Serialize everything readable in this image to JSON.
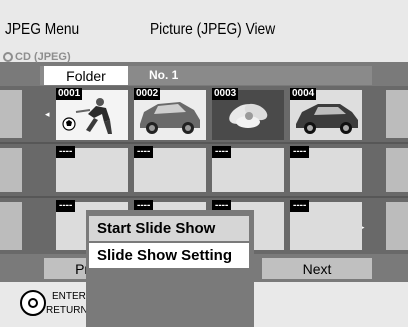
{
  "header": {
    "menu_title": "JPEG Menu",
    "view_title": "Picture (JPEG) View",
    "source": "CD (JPEG)"
  },
  "folder": {
    "tab_label": "Folder",
    "number": "No. 1"
  },
  "thumbnails": [
    {
      "label": "0001",
      "icon": "soccer-player"
    },
    {
      "label": "0002",
      "icon": "car"
    },
    {
      "label": "0003",
      "icon": "flower"
    },
    {
      "label": "0004",
      "icon": "car"
    },
    {
      "label": "----"
    },
    {
      "label": "----"
    },
    {
      "label": "----"
    },
    {
      "label": "----"
    },
    {
      "label": "----"
    },
    {
      "label": "----"
    },
    {
      "label": "----"
    },
    {
      "label": "----"
    }
  ],
  "navigation": {
    "prev_label": "Pre",
    "next_label": "Next"
  },
  "controls": {
    "enter_label": "ENTER",
    "return_label": "RETURN"
  },
  "popup_menu": {
    "items": [
      "Start Slide Show",
      "Slide Show Setting"
    ],
    "selected_index": 1
  },
  "colors": {
    "panel_gray": "#7a7a7a",
    "grid_dark": "#575757",
    "cell_light": "#dcdcdc"
  }
}
